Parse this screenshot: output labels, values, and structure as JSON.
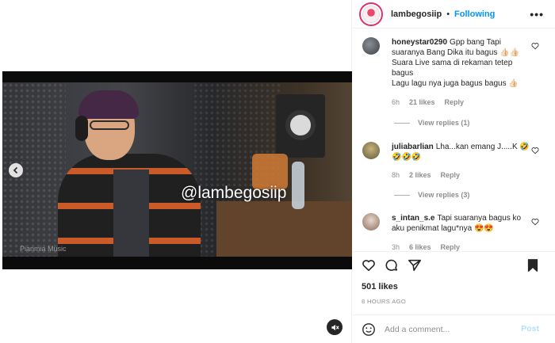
{
  "media": {
    "watermark": "@lambegosiip",
    "source_mark": "Pianmia Music"
  },
  "post": {
    "author": "lambegosiip",
    "separator": "•",
    "follow_status": "Following",
    "more_label": "•••",
    "likes": "501 likes",
    "time_ago": "8 HOURS AGO"
  },
  "comments": [
    {
      "user": "honeystar0290",
      "text": "Gpp bang Tapi suaranya Bang Dika itu bagus 👍🏻👍🏻",
      "line2": "Suara Live sama di rekaman tetep bagus",
      "line3": "Lagu lagu nya juga bagus bagus 👍🏻",
      "time": "6h",
      "likes": "21 likes",
      "reply": "Reply",
      "view_replies": "View replies (1)"
    },
    {
      "user": "juliabarlian",
      "text": "Lha...kan emang J.....K 🤣🤣🤣🤣",
      "time": "8h",
      "likes": "2 likes",
      "reply": "Reply",
      "view_replies": "View replies (3)"
    },
    {
      "user": "s_intan_s.e",
      "text": "Tapi suaranya bagus ko aku penikmat lagu*nya 😍😍",
      "time": "3h",
      "likes": "6 likes",
      "reply": "Reply"
    }
  ],
  "add_comment": {
    "placeholder": "Add a comment...",
    "post_label": "Post"
  },
  "colors": {
    "link_blue": "#0095f6",
    "post_disabled": "#b2dffc",
    "muted_text": "#8e8e8e"
  }
}
